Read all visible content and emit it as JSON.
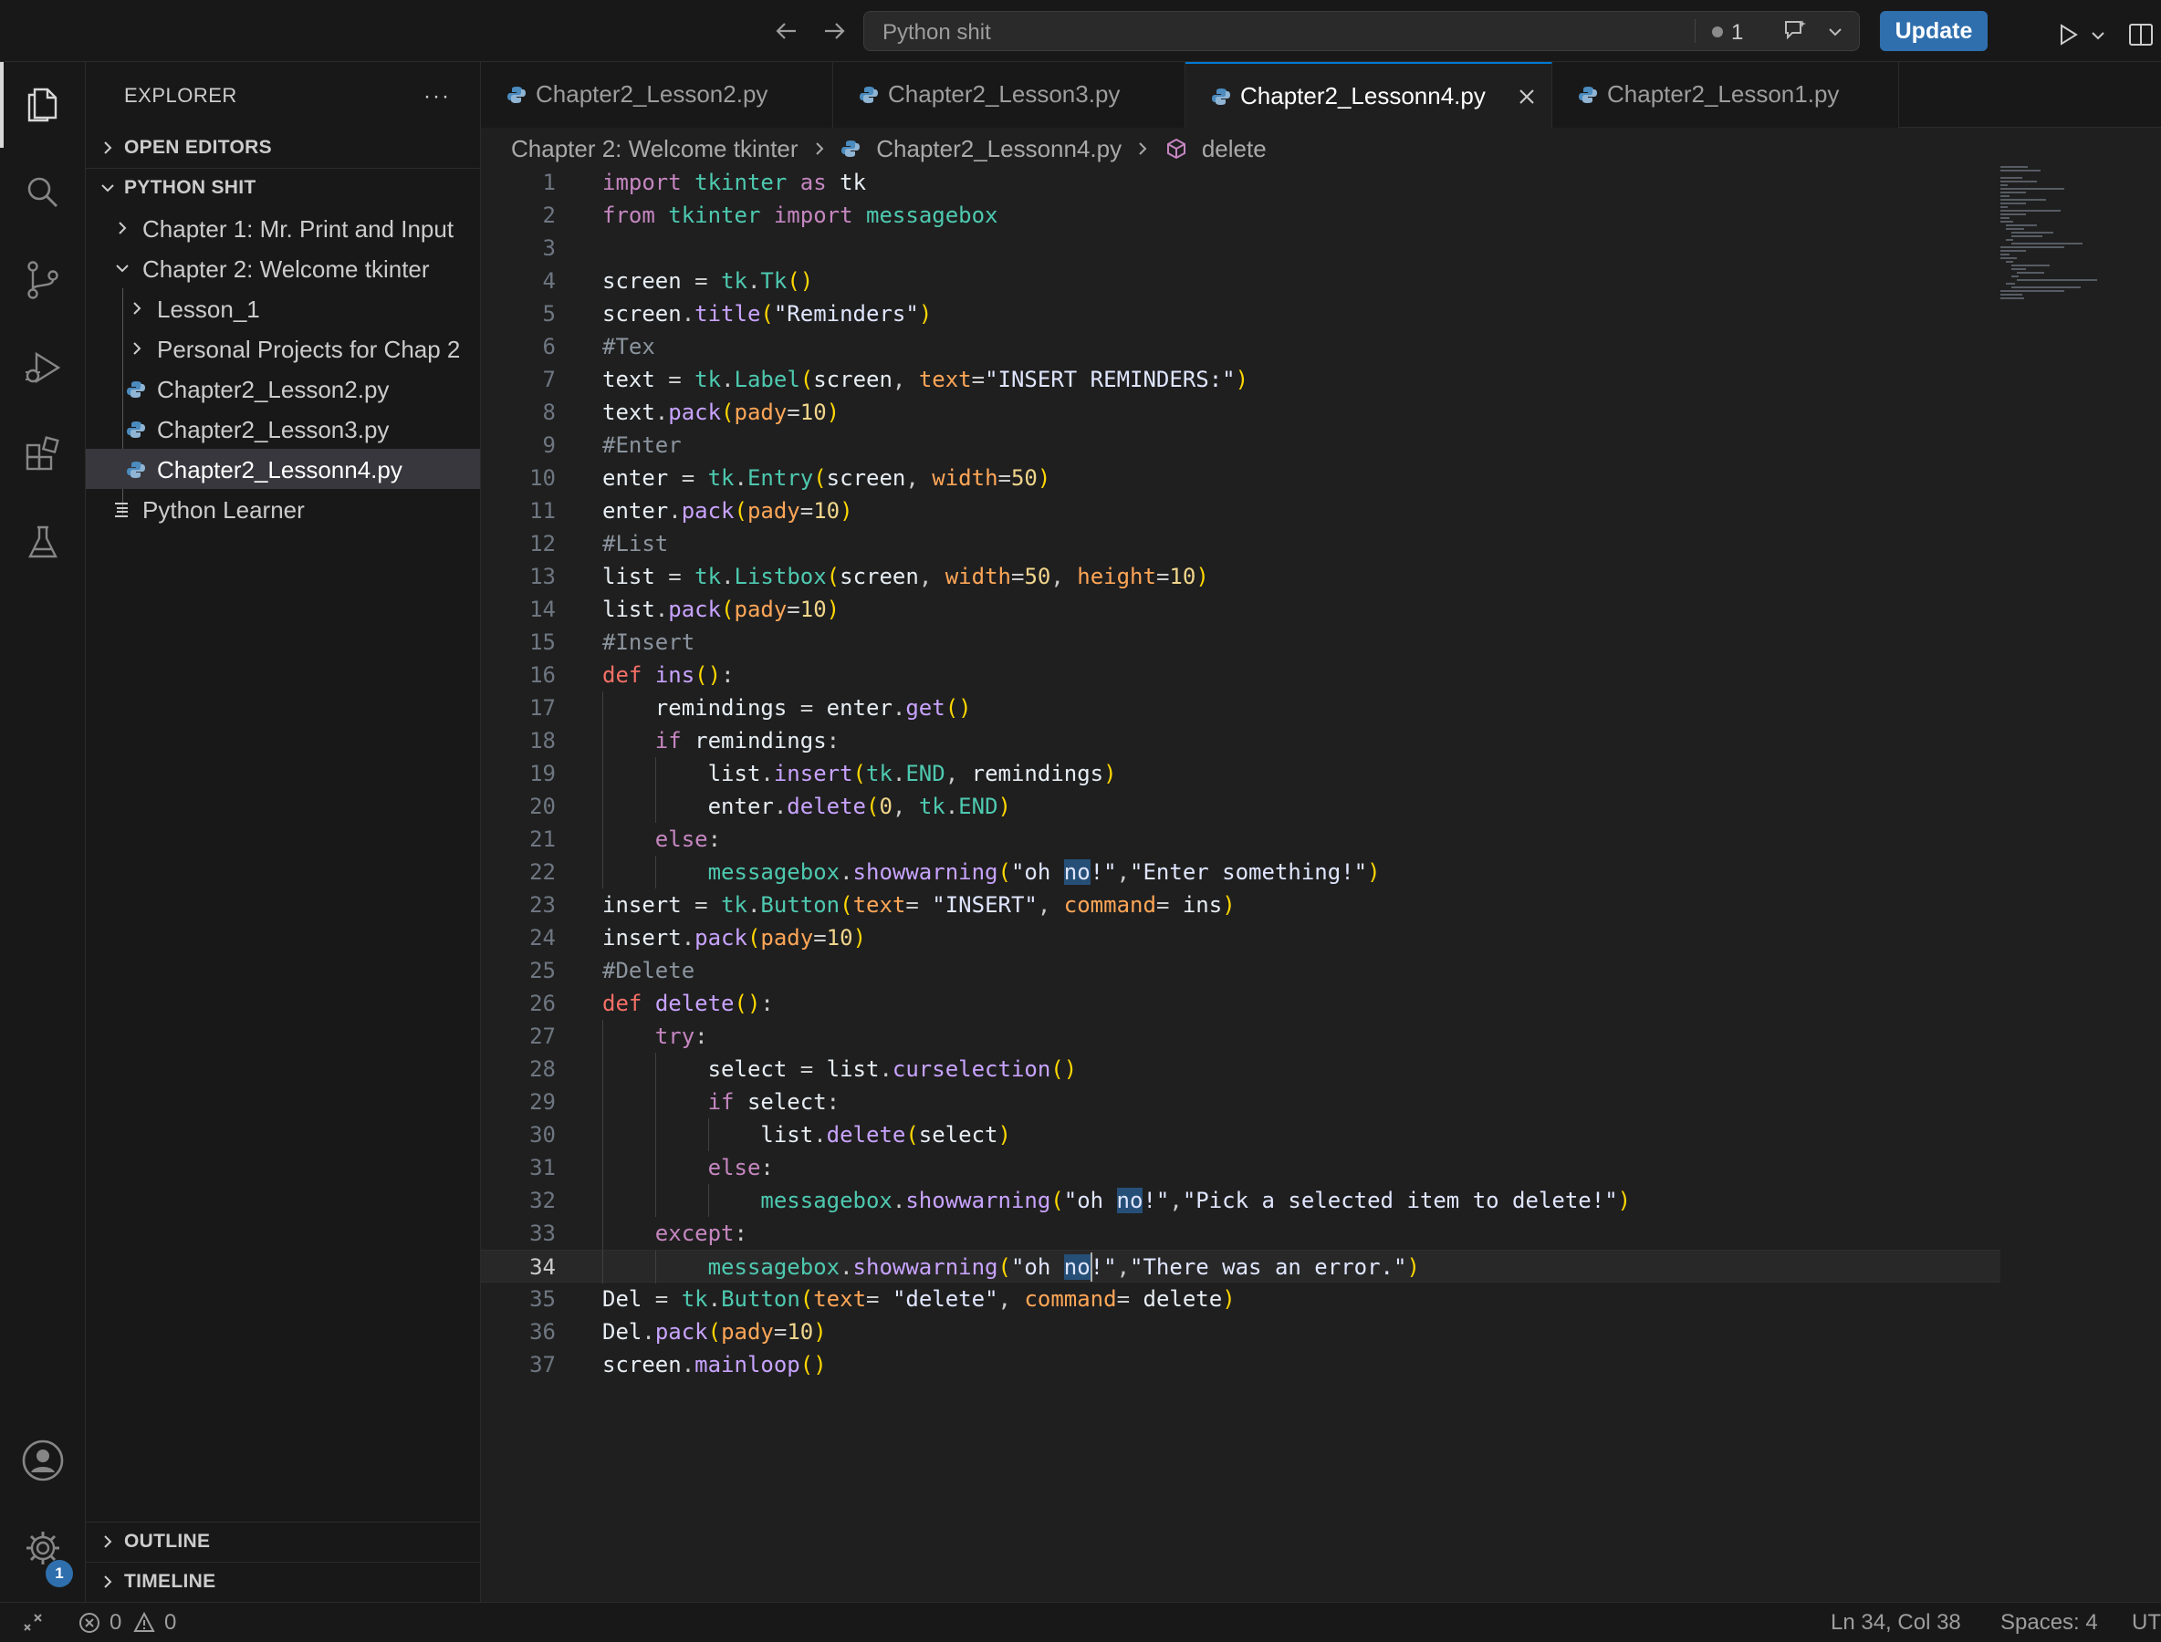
{
  "titlebar": {
    "search_text": "Python shit",
    "notification_count": "1",
    "update_label": "Update"
  },
  "explorer": {
    "title": "EXPLORER",
    "more": "···",
    "open_editors": "OPEN EDITORS",
    "folder": "PYTHON SHIT",
    "items": [
      {
        "label": "Chapter 1: Mr. Print and Input"
      },
      {
        "label": "Chapter 2: Welcome tkinter"
      },
      {
        "label": "Lesson_1"
      },
      {
        "label": "Personal Projects for Chap 2"
      },
      {
        "label": "Chapter2_Lesson2.py"
      },
      {
        "label": "Chapter2_Lesson3.py"
      },
      {
        "label": "Chapter2_Lessonn4.py"
      },
      {
        "label": "Python Learner"
      }
    ],
    "outline": "OUTLINE",
    "timeline": "TIMELINE"
  },
  "tabs": [
    {
      "label": "Chapter2_Lesson2.py"
    },
    {
      "label": "Chapter2_Lesson3.py"
    },
    {
      "label": "Chapter2_Lessonn4.py"
    },
    {
      "label": "Chapter2_Lesson1.py"
    }
  ],
  "breadcrumb": {
    "folder": "Chapter 2: Welcome tkinter",
    "file": "Chapter2_Lessonn4.py",
    "symbol": "delete"
  },
  "editor": {
    "current_line": 34,
    "lines": [
      "import tkinter as tk",
      "from tkinter import messagebox",
      "",
      "screen = tk.Tk()",
      "screen.title(\"Reminders\")",
      "#Tex",
      "text = tk.Label(screen, text=\"INSERT REMINDERS:\")",
      "text.pack(pady=10)",
      "#Enter",
      "enter = tk.Entry(screen, width=50)",
      "enter.pack(pady=10)",
      "#List",
      "list = tk.Listbox(screen, width=50, height=10)",
      "list.pack(pady=10)",
      "#Insert",
      "def ins():",
      "    remindings = enter.get()",
      "    if remindings:",
      "        list.insert(tk.END, remindings)",
      "        enter.delete(0, tk.END)",
      "    else:",
      "        messagebox.showwarning(\"oh no!\",\"Enter something!\")",
      "insert = tk.Button(text= \"INSERT\", command= ins)",
      "insert.pack(pady=10)",
      "#Delete",
      "def delete():",
      "    try:",
      "        select = list.curselection()",
      "        if select:",
      "            list.delete(select)",
      "        else:",
      "            messagebox.showwarning(\"oh no!\",\"Pick a selected item to delete!\")",
      "    except:",
      "        messagebox.showwarning(\"oh no!\",\"There was an error.\")",
      "Del = tk.Button(text= \"delete\", command= delete)",
      "Del.pack(pady=10)",
      "screen.mainloop()"
    ]
  },
  "statusbar": {
    "errors": "0",
    "warnings": "0",
    "position": "Ln 34, Col 38",
    "spaces": "Spaces: 4",
    "encoding": "UT"
  },
  "settings_badge": "1"
}
